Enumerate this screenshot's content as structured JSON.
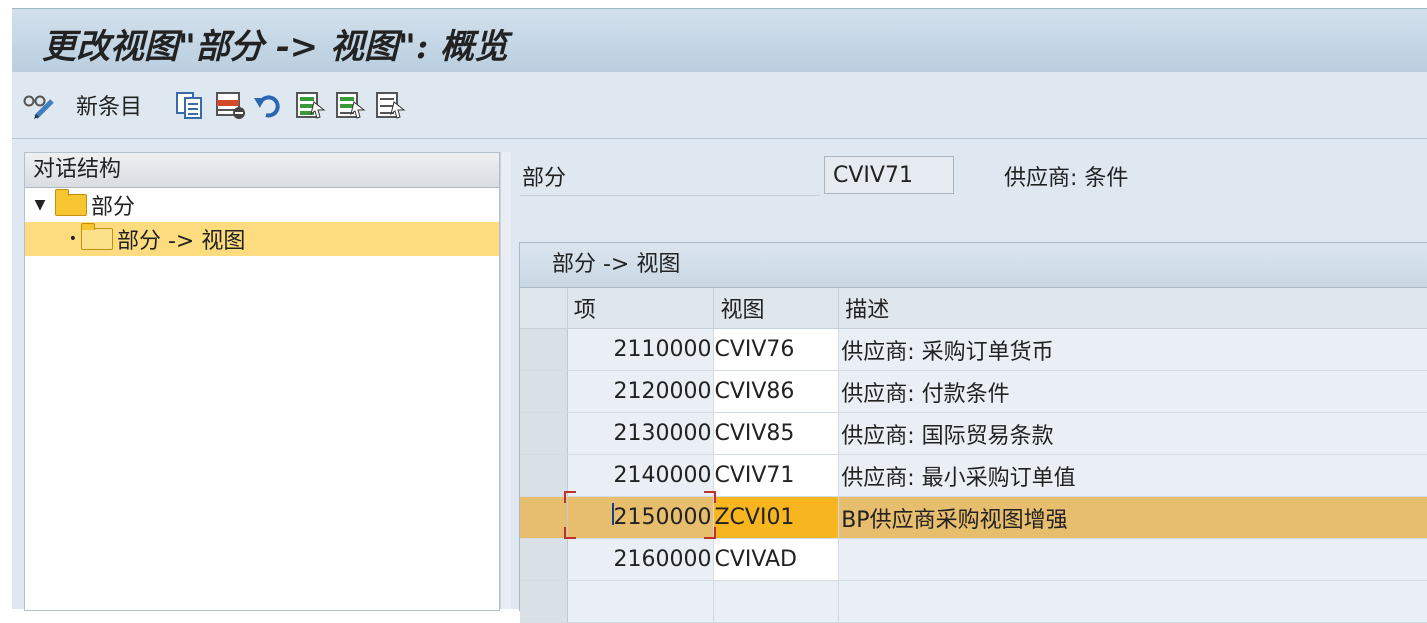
{
  "title": "更改视图\"部分 -> 视图\": 概览",
  "toolbar": {
    "new_entries_label": "新条目",
    "icons": [
      "glasses-pencil-icon",
      "copy-icon",
      "delete-icon",
      "undo-icon",
      "select-all-icon",
      "select-block-icon",
      "deselect-all-icon"
    ]
  },
  "tree": {
    "header": "对话结构",
    "nodes": [
      {
        "label": "部分",
        "expanded": true,
        "level": 0
      },
      {
        "label": "部分 -> 视图",
        "selected": true,
        "level": 1
      }
    ]
  },
  "detail": {
    "field_label": "部分",
    "field_value": "CVIV71",
    "field_desc": "供应商: 条件"
  },
  "grid": {
    "title": "部分 -> 视图",
    "columns": [
      "项",
      "视图",
      "描述"
    ],
    "rows": [
      {
        "item": "2110000",
        "view": "CVIV76",
        "desc": "供应商: 采购订单货币"
      },
      {
        "item": "2120000",
        "view": "CVIV86",
        "desc": "供应商: 付款条件"
      },
      {
        "item": "2130000",
        "view": "CVIV85",
        "desc": "供应商: 国际贸易条款"
      },
      {
        "item": "2140000",
        "view": "CVIV71",
        "desc": "供应商: 最小采购订单值"
      },
      {
        "item": "2150000",
        "view": "ZCVI01",
        "desc": "BP供应商采购视图增强",
        "selected": true
      },
      {
        "item": "2160000",
        "view": "CVIVAD",
        "desc": ""
      }
    ]
  },
  "colors": {
    "highlight_row": "#e7bd6e",
    "highlight_view": "#f7b51f",
    "tree_selected": "#fddc7f"
  }
}
